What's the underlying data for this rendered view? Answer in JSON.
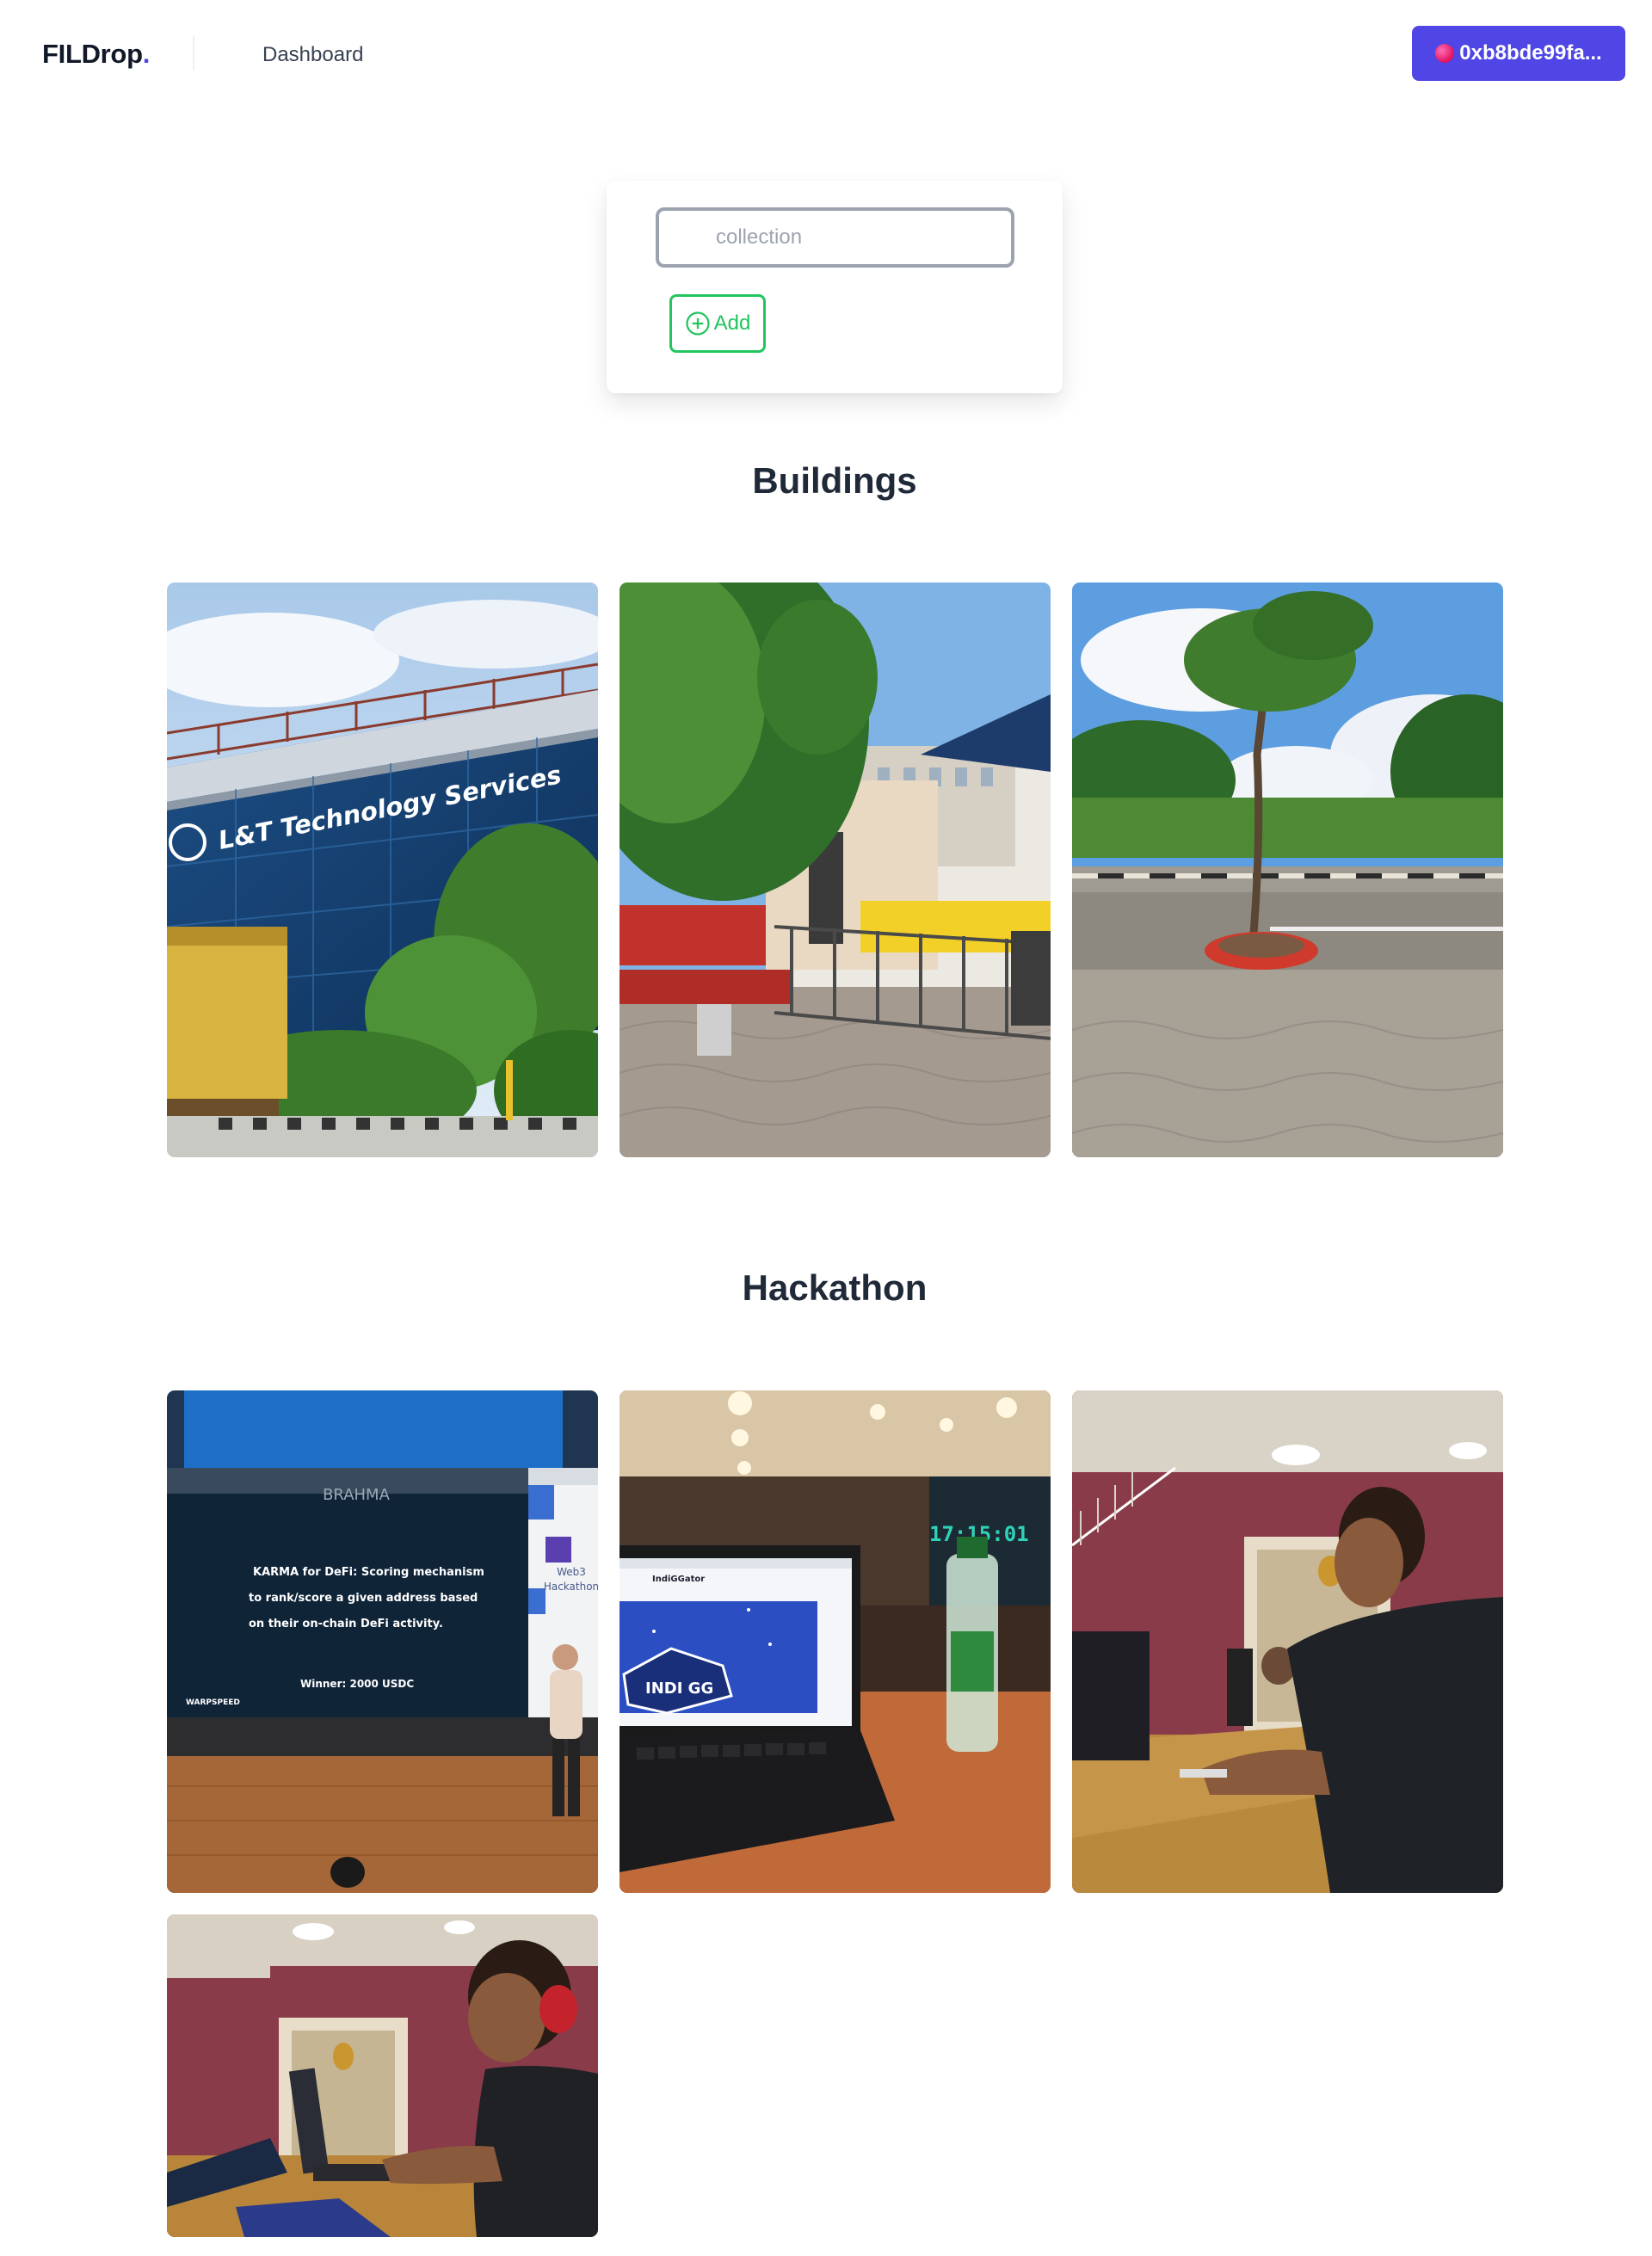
{
  "header": {
    "brand": "FILDrop",
    "brand_dot": ".",
    "nav_dashboard": "Dashboard",
    "wallet_address": "0xb8bde99fa..."
  },
  "form": {
    "placeholder": "collection",
    "add_label": "Add"
  },
  "collections": [
    {
      "title": "Buildings",
      "photos": [
        {
          "name": "office-building-photo",
          "caption": "L&T Technology Services"
        },
        {
          "name": "garden-bench-photo"
        },
        {
          "name": "tree-parking-photo"
        }
      ]
    },
    {
      "title": "Hackathon",
      "photos": [
        {
          "name": "stage-presentation-photo",
          "screen_brand": "BRAHMA",
          "screen_text_1": "KARMA for DeFi: Scoring mechanism",
          "screen_text_2": "to rank/score a given address based",
          "screen_text_3": "on their on-chain DeFi activity.",
          "screen_prize": "Winner: 2000 USDC",
          "screen_logo": "WARPSPEED",
          "side_text_1": "Web3",
          "side_text_2": "Hackathon"
        },
        {
          "name": "laptop-game-photo",
          "clock": "17:15:01",
          "app_title": "IndiGGator",
          "logo_text": "INDI GG"
        },
        {
          "name": "coder-laptop-photo"
        },
        {
          "name": "coder-headphones-photo"
        }
      ]
    }
  ],
  "colors": {
    "accent": "#4f46e5",
    "success": "#22c55e",
    "input_border": "#9ca3af"
  }
}
